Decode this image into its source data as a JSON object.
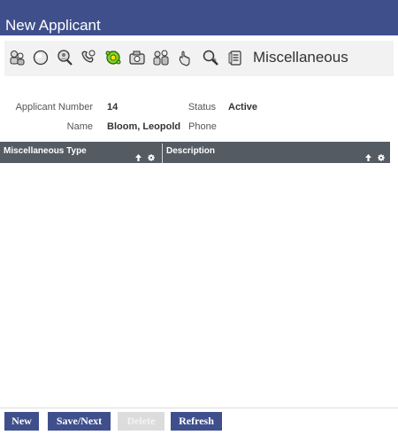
{
  "window": {
    "title": "New Applicant"
  },
  "toolbar": {
    "icons": [
      "applicant-icon",
      "sphere-icon",
      "search-person-icon",
      "phone-icon",
      "miscellaneous-icon",
      "camera-icon",
      "group-icon",
      "hand-icon",
      "magnify-icon",
      "notes-icon"
    ],
    "section_label": "Miscellaneous"
  },
  "applicant": {
    "number_label": "Applicant Number",
    "number": "14",
    "status_label": "Status",
    "status": "Active",
    "name_label": "Name",
    "name": "Bloom, Leopold",
    "phone_label": "Phone",
    "phone": ""
  },
  "grid": {
    "columns": [
      {
        "label": "Miscellaneous Type"
      },
      {
        "label": "Description"
      }
    ],
    "rows": []
  },
  "buttons": {
    "new": "New",
    "save_next": "Save/Next",
    "delete": "Delete",
    "refresh": "Refresh"
  },
  "colors": {
    "header": "#3f4f8c",
    "grid_header": "#555b63",
    "button": "#3f4f8c",
    "button_disabled": "#dcdcdc",
    "highlight_icon": "#6dc01a"
  }
}
